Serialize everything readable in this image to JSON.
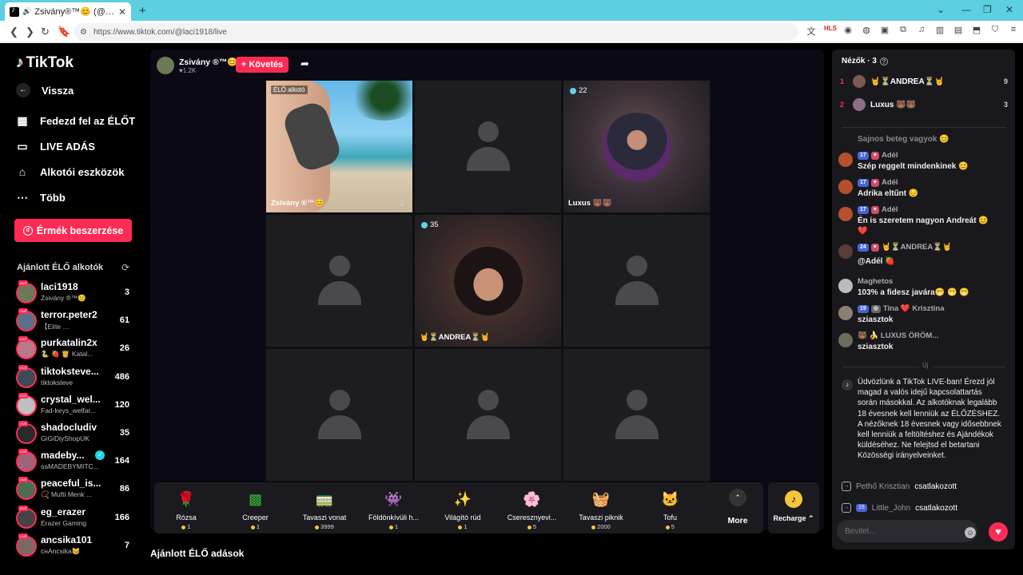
{
  "browser": {
    "tab_title": "Zsivány®™😊 (@laci1918) É...",
    "url": "https://www.tiktok.com/@laci1918/live"
  },
  "sidebar": {
    "logo": "TikTok",
    "back": "Vissza",
    "items": [
      {
        "label": "Fedezd fel az ÉLŐT",
        "icon": "calendar-icon"
      },
      {
        "label": "LIVE ADÁS",
        "icon": "video-camera-icon"
      },
      {
        "label": "Alkotói eszközök",
        "icon": "creator-tools-icon"
      },
      {
        "label": "Több",
        "icon": "more-dots-icon"
      }
    ],
    "coins_button": "Érmék beszerzése",
    "recommended_header": "Ajánlott ÉLŐ alkotók",
    "creators": [
      {
        "name": "laci1918",
        "sub": "Zsivány ®™😊",
        "count": "3"
      },
      {
        "name": "terror.peter2",
        "sub": "【Elite …",
        "count": "61"
      },
      {
        "name": "purkatalin2x",
        "sub": "🐍 🍓 👸 Katal...",
        "count": "26"
      },
      {
        "name": "tiktoksteve...",
        "sub": "tiktoksteve",
        "count": "486"
      },
      {
        "name": "crystal_wel...",
        "sub": "Fad-keys_welfar...",
        "count": "120"
      },
      {
        "name": "shadocludiv",
        "sub": "GiGiDiyShopUK",
        "count": "35"
      },
      {
        "name": "madeby...",
        "sub": "ɢsMADEBYMITC...",
        "count": "164",
        "verified": true
      },
      {
        "name": "peaceful_is...",
        "sub": "📿 Mufti Menk ...",
        "count": "86"
      },
      {
        "name": "eg_erazer",
        "sub": "Erazer Gaming",
        "count": "166"
      },
      {
        "name": "ancsika101",
        "sub": "ᴄнAncsika😽",
        "count": "7"
      }
    ]
  },
  "host": {
    "name": "Zsivány ®™😊",
    "likes": "♥1.2K",
    "follow": "+ Követés"
  },
  "grid": {
    "live_creator_badge": "ÉLŐ alkotó",
    "cell1_label": "Zsivány ®™😊",
    "cell3_viewers": "22",
    "cell3_label": "Luxus 🐻🐻",
    "cell5_viewers": "35",
    "cell5_label": "🤘⏳ANDREA⏳🤘"
  },
  "gifts": [
    {
      "name": "Rózsa",
      "price": "1",
      "icon": "rose-icon",
      "color": "#e0234b"
    },
    {
      "name": "Creeper",
      "price": "1",
      "icon": "creeper-icon",
      "color": "#38b13a"
    },
    {
      "name": "Tavaszi vonat",
      "price": "3999",
      "icon": "train-icon",
      "color": "#f08fb5"
    },
    {
      "name": "Földönkívüli h...",
      "price": "1",
      "icon": "alien-icon",
      "color": "#7b3fa0"
    },
    {
      "name": "Világító rúd",
      "price": "1",
      "icon": "glowstick-icon",
      "color": "#d07be8"
    },
    {
      "name": "Cseresznyevi...",
      "price": "5",
      "icon": "cherry-blossom-icon",
      "color": "#f6a7c7"
    },
    {
      "name": "Tavaszi piknik",
      "price": "2000",
      "icon": "picnic-icon",
      "color": "#b9a36c"
    },
    {
      "name": "Tofu",
      "price": "5",
      "icon": "tofu-icon",
      "color": "#e7892f"
    }
  ],
  "more_label": "More",
  "recharge_label": "Recharge ⌃",
  "recommended_section": "Ajánlott ÉLŐ adások",
  "viewers": {
    "title": "Nézők · 3",
    "list": [
      {
        "rank": "1",
        "name": "🤘⏳ANDREA⏳🤘",
        "score": "9"
      },
      {
        "rank": "2",
        "name": "Luxus 🐻🐻",
        "score": "3"
      }
    ]
  },
  "chat": [
    {
      "user": "",
      "text": "Sajnos beteg vagyok 😊",
      "level": ""
    },
    {
      "user": "Adél",
      "text": "Szép reggelt mindenkinek 😊",
      "level": "17"
    },
    {
      "user": "Adél",
      "text": "Adrika eltűnt 😔",
      "level": "17"
    },
    {
      "user": "Adél",
      "text": "Én is szeretem nagyon Andreát 😊",
      "text2": "❤️",
      "level": "17"
    },
    {
      "user": "🤘⏳ANDREA⏳🤘",
      "text": "@Adél 🍓",
      "level": "24"
    },
    {
      "user": "Maghetos",
      "text": "103% a fidesz javára😁 😁 😁",
      "level": ""
    },
    {
      "user": "Tina ❤️ Krisztina",
      "text": "sziasztok",
      "level": "19"
    },
    {
      "user": "🐻 🍌 LUXUS ÖRÖM...",
      "text": "sziasztok",
      "level": ""
    }
  ],
  "system_message": "Üdvözlünk a TikTok LIVE-ban! Érezd jól magad a valós idejű kapcsolattartás során másokkal. Az alkotóknak legalább 18 évesnek kell lenniük az ÉLŐZÉSHEZ. A nézőknek 18 évesnek vagy idősebbnek kell lenniük a feltöltéshez és Ajándékok küldéséhez. Ne felejtsd el betartani Közösségi irányelveinket.",
  "new_divider": "Új",
  "joins": [
    {
      "name": "Pethő Krisztian",
      "action": "csatlakozott",
      "level": ""
    },
    {
      "name": "Little_John",
      "action": "csatlakozott",
      "level": "15"
    }
  ],
  "input_placeholder": "Bevitel...",
  "colors": {
    "accent": "#fe2c55",
    "cyan": "#20d5ec",
    "coin": "#f7c53b"
  }
}
